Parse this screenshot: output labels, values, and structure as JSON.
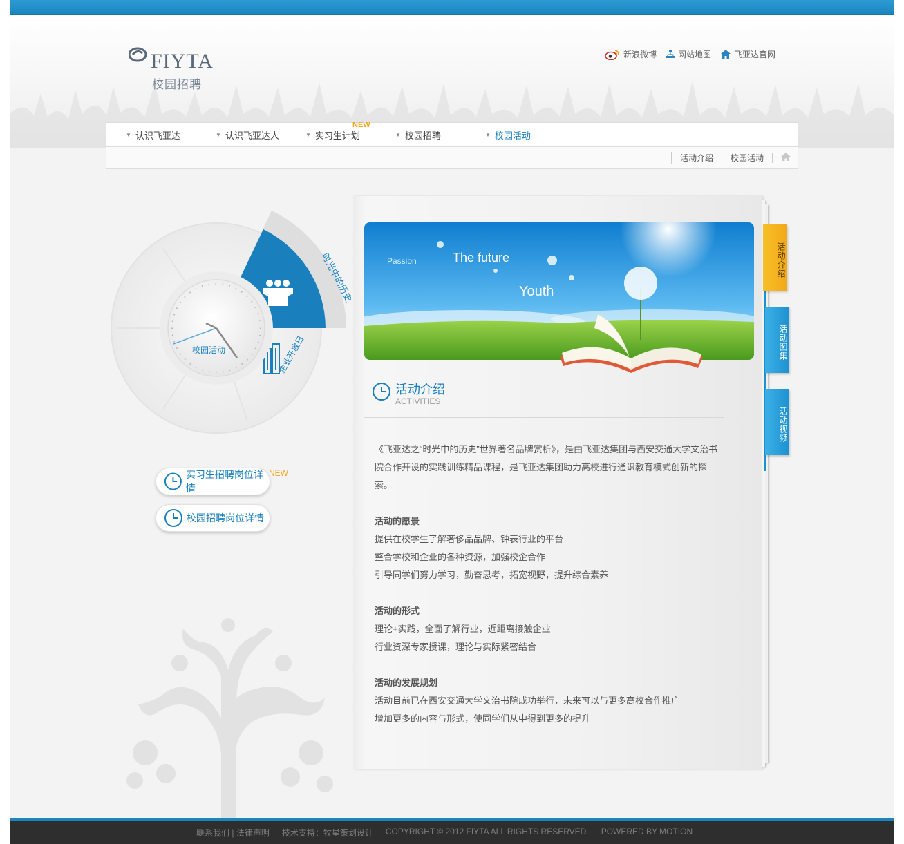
{
  "header": {
    "logo_word": "FIYTA",
    "logo_sub": "校园招聘",
    "links": [
      {
        "label": "新浪微博",
        "icon": "weibo-icon"
      },
      {
        "label": "网站地图",
        "icon": "sitemap-icon"
      },
      {
        "label": "飞亚达官网",
        "icon": "home-icon"
      }
    ]
  },
  "nav": {
    "items": [
      {
        "label": "认识飞亚达"
      },
      {
        "label": "认识飞亚达人"
      },
      {
        "label": "实习生计划",
        "badge": "NEW"
      },
      {
        "label": "校园招聘"
      },
      {
        "label": "校园活动"
      }
    ],
    "active_index": 4
  },
  "breadcrumb": {
    "items": [
      "活动介绍",
      "校园活动"
    ],
    "home_icon": "home-icon"
  },
  "wheel": {
    "segment_top": "时光中的历史",
    "segment_bottom": "企业开放日",
    "clock_label": "校园活动"
  },
  "side_buttons": [
    {
      "label": "实习生招聘岗位详情",
      "badge": "NEW"
    },
    {
      "label": "校园招聘岗位详情"
    }
  ],
  "banner": {
    "word1": "Passion",
    "word2": "The future",
    "word3": "Youth"
  },
  "section": {
    "title": "活动介绍",
    "subtitle": "ACTIVITIES",
    "intro": "《飞亚达之“时光中的历史”世界著名品牌赏析》，是由飞亚达集团与西安交通大学文治书院合作开设的实践训练精品课程，是飞亚达集团助力高校进行通识教育模式创新的探索。",
    "blocks": [
      {
        "heading": "活动的愿景",
        "lines": [
          "提供在校学生了解奢侈品品牌、钟表行业的平台",
          "整合学校和企业的各种资源，加强校企合作",
          "引导同学们努力学习，勤奋思考，拓宽视野，提升综合素养"
        ]
      },
      {
        "heading": "活动的形式",
        "lines": [
          "理论+实践，全面了解行业，近距离接触企业",
          "行业资深专家授课，理论与实际紧密结合"
        ]
      },
      {
        "heading": "活动的发展规划",
        "lines": [
          "活动目前已在西安交通大学文治书院成功举行，未来可以与更多高校合作推广",
          "增加更多的内容与形式，使同学们从中得到更多的提升"
        ]
      }
    ]
  },
  "tabs": [
    {
      "label": "活动介绍",
      "color": "#f2a91a"
    },
    {
      "label": "活动图集",
      "color": "#1d92d1"
    },
    {
      "label": "活动视频",
      "color": "#1d92d1"
    }
  ],
  "footer": {
    "contact": "联系我们",
    "sep": "|",
    "legal": "法律声明",
    "support": "技术支持：牧星策划设计",
    "copyright": "COPYRIGHT © 2012 FIYTA ALL RIGHTS RESERVED.",
    "powered": "POWERED BY MOTION"
  },
  "colors": {
    "brand_blue": "#1a80bd",
    "accent_orange": "#f2a31a",
    "footer_bg": "#2e2e2e"
  }
}
